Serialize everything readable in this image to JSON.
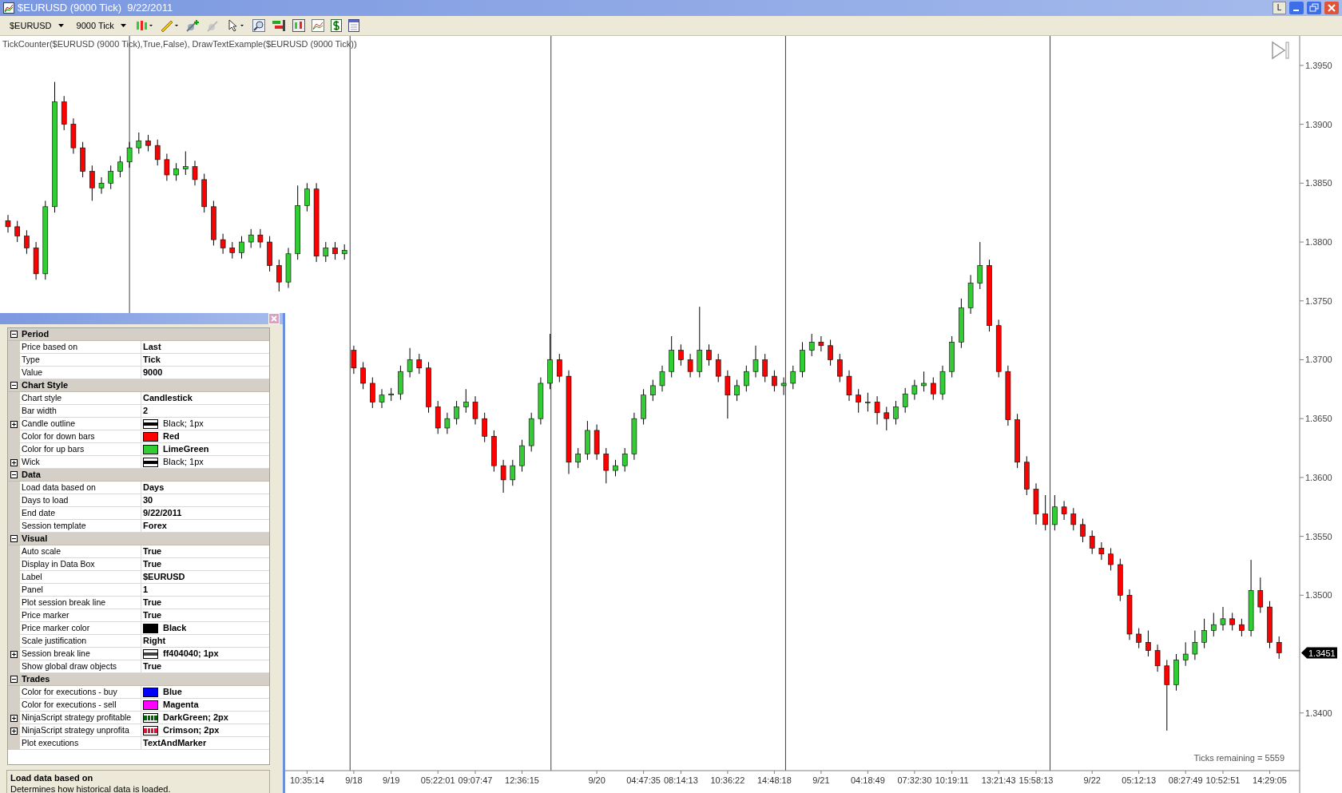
{
  "window": {
    "title": "$EURUSD (9000 Tick)  9/22/2011",
    "buttons": [
      "L"
    ]
  },
  "toolbar": {
    "instrument": "$EURUSD",
    "period": "9000 Tick"
  },
  "chart": {
    "indicator_label": "TickCounter($EURUSD (9000 Tick),True,False), DrawTextExample($EURUSD (9000 Tick))",
    "ticks_remaining": "Ticks remaining = 5559",
    "price_marker": "1.3451",
    "chart_data": {
      "type": "candlestick",
      "ylim": [
        1.3351,
        1.3973
      ],
      "yticks": [
        {
          "value": 1.395,
          "label": "1.3950"
        },
        {
          "value": 1.39,
          "label": "1.3900"
        },
        {
          "value": 1.385,
          "label": "1.3850"
        },
        {
          "value": 1.38,
          "label": "1.3800"
        },
        {
          "value": 1.375,
          "label": "1.3750"
        },
        {
          "value": 1.37,
          "label": "1.3700"
        },
        {
          "value": 1.365,
          "label": "1.3650"
        },
        {
          "value": 1.36,
          "label": "1.3600"
        },
        {
          "value": 1.355,
          "label": "1.3550"
        },
        {
          "value": 1.35,
          "label": "1.3500"
        },
        {
          "value": 1.34,
          "label": "1.3400"
        }
      ],
      "categories": [
        null,
        null,
        null,
        null,
        null,
        null,
        null,
        null,
        null,
        null,
        null,
        null,
        null,
        null,
        null,
        null,
        null,
        null,
        null,
        null,
        null,
        null,
        null,
        null,
        null,
        null,
        null,
        null,
        null,
        null,
        null,
        null,
        "10:35:14",
        null,
        null,
        null,
        null,
        "9/18",
        null,
        null,
        null,
        "9/19",
        null,
        null,
        null,
        null,
        "05:22:01",
        null,
        null,
        null,
        "09:07:47",
        null,
        null,
        null,
        null,
        "12:36:15",
        null,
        null,
        null,
        null,
        null,
        null,
        null,
        "9/20",
        null,
        null,
        null,
        null,
        "04:47:35",
        null,
        null,
        null,
        "08:14:13",
        null,
        null,
        null,
        null,
        "10:36:22",
        null,
        null,
        null,
        null,
        "14:48:18",
        null,
        null,
        null,
        null,
        "9/21",
        null,
        null,
        null,
        null,
        "04:18:49",
        null,
        null,
        null,
        null,
        "07:32:30",
        null,
        null,
        null,
        "10:19:11",
        null,
        null,
        null,
        null,
        "13:21:43",
        null,
        null,
        null,
        "15:58:13",
        null,
        null,
        null,
        null,
        null,
        "9/22",
        null,
        null,
        null,
        null,
        "05:12:13",
        null,
        null,
        null,
        null,
        "08:27:49",
        null,
        null,
        null,
        "10:52:51",
        null,
        null,
        null,
        null,
        "14:29:05",
        null
      ],
      "ohlc": [
        [
          1.3818,
          1.3823,
          1.3808,
          1.3813
        ],
        [
          1.3813,
          1.3818,
          1.38,
          1.3805
        ],
        [
          1.3805,
          1.381,
          1.379,
          1.3795
        ],
        [
          1.3795,
          1.38,
          1.3768,
          1.3773
        ],
        [
          1.3773,
          1.3835,
          1.3768,
          1.383
        ],
        [
          1.383,
          1.3936,
          1.3825,
          1.3919
        ],
        [
          1.3919,
          1.3924,
          1.3895,
          1.39
        ],
        [
          1.39,
          1.3905,
          1.3875,
          1.388
        ],
        [
          1.388,
          1.3885,
          1.3855,
          1.386
        ],
        [
          1.386,
          1.3865,
          1.3835,
          1.3846
        ],
        [
          1.3846,
          1.3855,
          1.3841,
          1.385
        ],
        [
          1.385,
          1.3865,
          1.3845,
          1.386
        ],
        [
          1.386,
          1.3873,
          1.3855,
          1.3868
        ],
        [
          1.3868,
          1.3885,
          1.3863,
          1.388
        ],
        [
          1.388,
          1.3893,
          1.3875,
          1.3886
        ],
        [
          1.3886,
          1.3891,
          1.3877,
          1.3882
        ],
        [
          1.3882,
          1.3887,
          1.3865,
          1.387
        ],
        [
          1.387,
          1.3875,
          1.3852,
          1.3857
        ],
        [
          1.3857,
          1.3867,
          1.3852,
          1.3862
        ],
        [
          1.3862,
          1.3877,
          1.3857,
          1.3864
        ],
        [
          1.3864,
          1.3869,
          1.3848,
          1.3853
        ],
        [
          1.3853,
          1.3858,
          1.3825,
          1.383
        ],
        [
          1.383,
          1.3835,
          1.3797,
          1.3802
        ],
        [
          1.3802,
          1.3807,
          1.379,
          1.3795
        ],
        [
          1.3795,
          1.38,
          1.3786,
          1.3791
        ],
        [
          1.3791,
          1.3805,
          1.3786,
          1.38
        ],
        [
          1.38,
          1.3811,
          1.3795,
          1.3806
        ],
        [
          1.3806,
          1.3811,
          1.3795,
          1.38
        ],
        [
          1.38,
          1.3805,
          1.3775,
          1.378
        ],
        [
          1.378,
          1.3785,
          1.3758,
          1.3766
        ],
        [
          1.3766,
          1.3795,
          1.3761,
          1.379
        ],
        [
          1.379,
          1.3848,
          1.3785,
          1.3831
        ],
        [
          1.3831,
          1.385,
          1.3826,
          1.3845
        ],
        [
          1.3845,
          1.385,
          1.3783,
          1.3788
        ],
        [
          1.3788,
          1.38,
          1.3783,
          1.3795
        ],
        [
          1.3795,
          1.38,
          1.3785,
          1.379
        ],
        [
          1.379,
          1.3798,
          1.3785,
          1.3793
        ],
        [
          1.3708,
          1.3712,
          1.3688,
          1.3693
        ],
        [
          1.3693,
          1.3698,
          1.3675,
          1.368
        ],
        [
          1.368,
          1.3685,
          1.3659,
          1.3664
        ],
        [
          1.3664,
          1.3675,
          1.3659,
          1.367
        ],
        [
          1.367,
          1.3676,
          1.3665,
          1.3671
        ],
        [
          1.3671,
          1.3695,
          1.3666,
          1.369
        ],
        [
          1.369,
          1.371,
          1.3685,
          1.37
        ],
        [
          1.37,
          1.3705,
          1.3688,
          1.3693
        ],
        [
          1.3693,
          1.3698,
          1.3655,
          1.366
        ],
        [
          1.366,
          1.3665,
          1.3637,
          1.3642
        ],
        [
          1.3642,
          1.3655,
          1.3637,
          1.365
        ],
        [
          1.365,
          1.3665,
          1.3645,
          1.366
        ],
        [
          1.366,
          1.3675,
          1.3655,
          1.3664
        ],
        [
          1.3664,
          1.3669,
          1.3645,
          1.365
        ],
        [
          1.365,
          1.3655,
          1.363,
          1.3635
        ],
        [
          1.3635,
          1.364,
          1.3605,
          1.361
        ],
        [
          1.361,
          1.3615,
          1.3587,
          1.3598
        ],
        [
          1.3598,
          1.3615,
          1.3593,
          1.361
        ],
        [
          1.361,
          1.3632,
          1.3605,
          1.3627
        ],
        [
          1.3627,
          1.3655,
          1.3622,
          1.365
        ],
        [
          1.365,
          1.3685,
          1.3645,
          1.368
        ],
        [
          1.368,
          1.3722,
          1.3675,
          1.37
        ],
        [
          1.37,
          1.3705,
          1.3681,
          1.3686
        ],
        [
          1.3686,
          1.3691,
          1.3603,
          1.3613
        ],
        [
          1.3613,
          1.3625,
          1.3608,
          1.362
        ],
        [
          1.362,
          1.3648,
          1.3615,
          1.364
        ],
        [
          1.364,
          1.3645,
          1.3615,
          1.362
        ],
        [
          1.362,
          1.3625,
          1.3595,
          1.3606
        ],
        [
          1.3606,
          1.3615,
          1.3601,
          1.361
        ],
        [
          1.361,
          1.3625,
          1.3605,
          1.362
        ],
        [
          1.362,
          1.3655,
          1.3615,
          1.365
        ],
        [
          1.365,
          1.3675,
          1.3645,
          1.367
        ],
        [
          1.367,
          1.3683,
          1.3665,
          1.3678
        ],
        [
          1.3678,
          1.3695,
          1.3673,
          1.369
        ],
        [
          1.369,
          1.372,
          1.3685,
          1.3708
        ],
        [
          1.3708,
          1.3713,
          1.3695,
          1.37
        ],
        [
          1.37,
          1.3705,
          1.3685,
          1.369
        ],
        [
          1.369,
          1.3745,
          1.3685,
          1.3708
        ],
        [
          1.3708,
          1.3713,
          1.3695,
          1.37
        ],
        [
          1.37,
          1.3705,
          1.3681,
          1.3686
        ],
        [
          1.3686,
          1.3691,
          1.365,
          1.367
        ],
        [
          1.367,
          1.3683,
          1.3665,
          1.3678
        ],
        [
          1.3678,
          1.3695,
          1.3673,
          1.369
        ],
        [
          1.369,
          1.3712,
          1.3685,
          1.37
        ],
        [
          1.37,
          1.3705,
          1.3681,
          1.3686
        ],
        [
          1.3686,
          1.3691,
          1.3673,
          1.3678
        ],
        [
          1.3678,
          1.3685,
          1.367,
          1.368
        ],
        [
          1.368,
          1.3695,
          1.3675,
          1.369
        ],
        [
          1.369,
          1.3715,
          1.3685,
          1.3708
        ],
        [
          1.3708,
          1.3722,
          1.3703,
          1.3715
        ],
        [
          1.3715,
          1.372,
          1.3707,
          1.3712
        ],
        [
          1.3712,
          1.3717,
          1.3695,
          1.37
        ],
        [
          1.37,
          1.3705,
          1.3681,
          1.3686
        ],
        [
          1.3686,
          1.3691,
          1.3665,
          1.367
        ],
        [
          1.367,
          1.3675,
          1.3655,
          1.3664
        ],
        [
          1.3664,
          1.3672,
          1.3656,
          1.3664
        ],
        [
          1.3664,
          1.3669,
          1.3645,
          1.3655
        ],
        [
          1.3655,
          1.366,
          1.364,
          1.365
        ],
        [
          1.365,
          1.3665,
          1.3645,
          1.366
        ],
        [
          1.366,
          1.3676,
          1.3655,
          1.3671
        ],
        [
          1.3671,
          1.3683,
          1.3666,
          1.3678
        ],
        [
          1.3678,
          1.369,
          1.3673,
          1.368
        ],
        [
          1.368,
          1.3685,
          1.3666,
          1.3671
        ],
        [
          1.3671,
          1.3695,
          1.3666,
          1.369
        ],
        [
          1.369,
          1.372,
          1.3685,
          1.3715
        ],
        [
          1.3715,
          1.3752,
          1.371,
          1.3744
        ],
        [
          1.3744,
          1.3772,
          1.3739,
          1.3765
        ],
        [
          1.3765,
          1.38,
          1.376,
          1.378
        ],
        [
          1.378,
          1.3785,
          1.3724,
          1.3729
        ],
        [
          1.3729,
          1.3734,
          1.3685,
          1.369
        ],
        [
          1.369,
          1.3695,
          1.3644,
          1.3649
        ],
        [
          1.3649,
          1.3654,
          1.3608,
          1.3613
        ],
        [
          1.3613,
          1.3618,
          1.3585,
          1.359
        ],
        [
          1.359,
          1.3595,
          1.356,
          1.3569
        ],
        [
          1.3569,
          1.3585,
          1.3555,
          1.356
        ],
        [
          1.356,
          1.3585,
          1.3555,
          1.3575
        ],
        [
          1.3575,
          1.358,
          1.3564,
          1.3569
        ],
        [
          1.3569,
          1.3574,
          1.3555,
          1.356
        ],
        [
          1.356,
          1.3565,
          1.3545,
          1.355
        ],
        [
          1.355,
          1.3555,
          1.3535,
          1.354
        ],
        [
          1.354,
          1.3545,
          1.353,
          1.3535
        ],
        [
          1.3535,
          1.354,
          1.3521,
          1.3526
        ],
        [
          1.3526,
          1.3531,
          1.3495,
          1.35
        ],
        [
          1.35,
          1.3505,
          1.3462,
          1.3467
        ],
        [
          1.3467,
          1.3472,
          1.3455,
          1.346
        ],
        [
          1.346,
          1.347,
          1.3448,
          1.3453
        ],
        [
          1.3453,
          1.3458,
          1.3435,
          1.344
        ],
        [
          1.344,
          1.3445,
          1.3385,
          1.3424
        ],
        [
          1.3424,
          1.345,
          1.3419,
          1.3445
        ],
        [
          1.3445,
          1.346,
          1.344,
          1.345
        ],
        [
          1.345,
          1.347,
          1.3445,
          1.346
        ],
        [
          1.346,
          1.348,
          1.3455,
          1.347
        ],
        [
          1.347,
          1.3485,
          1.3465,
          1.3475
        ],
        [
          1.3475,
          1.349,
          1.347,
          1.348
        ],
        [
          1.348,
          1.3485,
          1.347,
          1.3475
        ],
        [
          1.3475,
          1.348,
          1.3465,
          1.347
        ],
        [
          1.347,
          1.353,
          1.3465,
          1.3504
        ],
        [
          1.3504,
          1.3515,
          1.3485,
          1.349
        ],
        [
          1.349,
          1.3495,
          1.3455,
          1.346
        ],
        [
          1.346,
          1.3465,
          1.3446,
          1.3451
        ]
      ]
    }
  },
  "properties": {
    "categories": [
      {
        "name": "Period",
        "expanded": true,
        "rows": [
          {
            "name": "Price based on",
            "value": "Last",
            "expandable": false,
            "default": false
          },
          {
            "name": "Type",
            "value": "Tick",
            "expandable": false,
            "default": false
          },
          {
            "name": "Value",
            "value": "9000",
            "expandable": false,
            "default": false
          }
        ]
      },
      {
        "name": "Chart Style",
        "expanded": true,
        "rows": [
          {
            "name": "Chart style",
            "value": "Candlestick",
            "expandable": false,
            "default": false
          },
          {
            "name": "Bar width",
            "value": "2",
            "expandable": false,
            "default": false
          },
          {
            "name": "Candle outline",
            "value": "Black; 1px",
            "expandable": true,
            "default": true,
            "swatch": {
              "kind": "line",
              "color": "#000000"
            }
          },
          {
            "name": "Color for down bars",
            "value": "Red",
            "expandable": false,
            "default": false,
            "swatch": {
              "kind": "fill",
              "color": "#ff0000"
            }
          },
          {
            "name": "Color for up bars",
            "value": "LimeGreen",
            "expandable": false,
            "default": false,
            "swatch": {
              "kind": "fill",
              "color": "#32cd32"
            }
          },
          {
            "name": "Wick",
            "value": "Black; 1px",
            "expandable": true,
            "default": true,
            "swatch": {
              "kind": "line",
              "color": "#000000"
            }
          }
        ]
      },
      {
        "name": "Data",
        "expanded": true,
        "rows": [
          {
            "name": "Load data based on",
            "value": "Days",
            "expandable": false,
            "default": false
          },
          {
            "name": "Days to load",
            "value": "30",
            "expandable": false,
            "default": false
          },
          {
            "name": "End date",
            "value": "9/22/2011",
            "expandable": false,
            "default": false
          },
          {
            "name": "Session template",
            "value": "Forex",
            "expandable": false,
            "default": false
          }
        ]
      },
      {
        "name": "Visual",
        "expanded": true,
        "rows": [
          {
            "name": "Auto scale",
            "value": "True",
            "expandable": false,
            "default": false
          },
          {
            "name": "Display in Data Box",
            "value": "True",
            "expandable": false,
            "default": false
          },
          {
            "name": "Label",
            "value": "$EURUSD",
            "expandable": false,
            "default": false
          },
          {
            "name": "Panel",
            "value": "1",
            "expandable": false,
            "default": false
          },
          {
            "name": "Plot session break line",
            "value": "True",
            "expandable": false,
            "default": false
          },
          {
            "name": "Price marker",
            "value": "True",
            "expandable": false,
            "default": false
          },
          {
            "name": "Price marker color",
            "value": "Black",
            "expandable": false,
            "default": false,
            "swatch": {
              "kind": "fill",
              "color": "#000000"
            }
          },
          {
            "name": "Scale justification",
            "value": "Right",
            "expandable": false,
            "default": false
          },
          {
            "name": "Session break line",
            "value": "ff404040; 1px",
            "expandable": true,
            "default": false,
            "swatch": {
              "kind": "line",
              "color": "#404040"
            }
          },
          {
            "name": "Show global draw objects",
            "value": "True",
            "expandable": false,
            "default": false
          }
        ]
      },
      {
        "name": "Trades",
        "expanded": true,
        "rows": [
          {
            "name": "Color for executions - buy",
            "value": "Blue",
            "expandable": false,
            "default": false,
            "swatch": {
              "kind": "fill",
              "color": "#0000ff"
            }
          },
          {
            "name": "Color for executions - sell",
            "value": "Magenta",
            "expandable": false,
            "default": false,
            "swatch": {
              "kind": "fill",
              "color": "#ff00ff"
            }
          },
          {
            "name": "NinjaScript strategy profitable",
            "value": "DarkGreen; 2px",
            "expandable": true,
            "default": false,
            "swatch": {
              "kind": "dotted",
              "color": "#006400"
            }
          },
          {
            "name": "NinjaScript strategy unprofita",
            "value": "Crimson; 2px",
            "expandable": true,
            "default": false,
            "swatch": {
              "kind": "dotted",
              "color": "#dc143c"
            }
          },
          {
            "name": "Plot executions",
            "value": "TextAndMarker",
            "expandable": false,
            "default": false
          }
        ]
      }
    ],
    "description": {
      "title": "Load data based on",
      "text": "Determines how historical data is loaded."
    }
  }
}
